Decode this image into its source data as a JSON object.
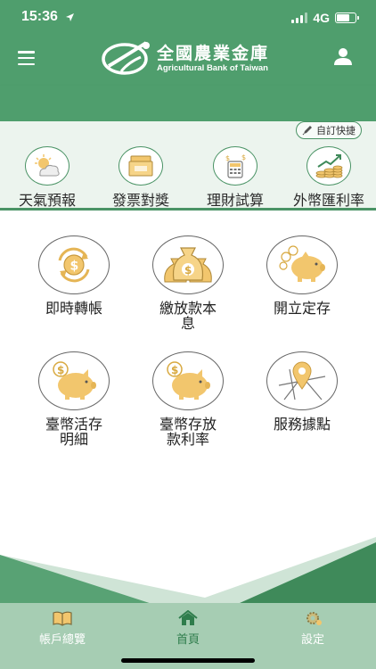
{
  "status_bar": {
    "time": "15:36",
    "network": "4G"
  },
  "header": {
    "logo_zh": "全國農業金庫",
    "logo_en": "Agricultural Bank of Taiwan",
    "menu_icon": "hamburger-icon",
    "user_icon": "user-icon"
  },
  "quick_bar": {
    "custom_label": "自訂快捷",
    "items": [
      {
        "label": "天氣預報",
        "icon": "weather-icon"
      },
      {
        "label": "發票對獎",
        "icon": "invoice-icon"
      },
      {
        "label": "理財試算",
        "icon": "calculator-icon"
      },
      {
        "label": "外幣匯利率",
        "icon": "exchange-rate-icon"
      }
    ]
  },
  "services": [
    {
      "label": "即時轉帳",
      "icon": "transfer-icon"
    },
    {
      "label": "繳放款本息",
      "icon": "money-bag-icon"
    },
    {
      "label": "開立定存",
      "icon": "piggy-bank-icon"
    },
    {
      "label": "臺幣活存明細",
      "icon": "piggy-bank-icon"
    },
    {
      "label": "臺幣存放款利率",
      "icon": "piggy-bank-icon"
    },
    {
      "label": "服務據點",
      "icon": "map-pin-icon"
    }
  ],
  "tabs": [
    {
      "label": "帳戶總覽",
      "icon": "book-icon"
    },
    {
      "label": "首頁",
      "icon": "home-icon",
      "active": true
    },
    {
      "label": "設定",
      "icon": "settings-icon"
    }
  ],
  "colors": {
    "brand_green": "#4f9e6d",
    "tab_bar": "#a6cdb3",
    "gold": "#f2c66d"
  }
}
